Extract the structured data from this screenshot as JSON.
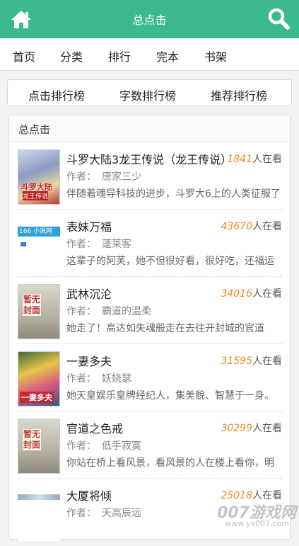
{
  "header": {
    "title": "总点击",
    "home_icon": "home-icon",
    "search_icon": "search-icon",
    "color": "#3cb98f"
  },
  "nav": [
    "首页",
    "分类",
    "排行",
    "完本",
    "书架"
  ],
  "tabs": [
    "点击排行榜",
    "字数排行榜",
    "推荐排行榜"
  ],
  "panel_title": "总点击",
  "unit": "人在看",
  "author_label": "作者：",
  "books": [
    {
      "name": "斗罗大陆3龙王传说（龙王传说）",
      "count": "1841",
      "author": "唐家三少",
      "desc": "伴随着魂导科技的进步，斗罗大6上的人类征服了",
      "cover_text": "斗罗大陆",
      "cover_sub": "龙王传说"
    },
    {
      "name": "表妹万福",
      "count": "43670",
      "author": "蓬莱客",
      "desc": "这辈子的阿芙，她不但很好看，很好吃，还福运",
      "cover_text": "166 小说网",
      "cover_sub": ""
    },
    {
      "name": "武林沉沦",
      "count": "34016",
      "author": "霸道的温柔",
      "desc": "她走了！高达如失魂般走在去往开封城的官道",
      "cover_text": "暂无封面",
      "cover_sub": ""
    },
    {
      "name": "一妻多夫",
      "count": "31595",
      "author": "妖娆瑟",
      "desc": "她天皇娱乐皇牌经纪人，集美貌、智慧于一身。",
      "cover_text": "一妻多夫",
      "cover_sub": ""
    },
    {
      "name": "官道之色戒",
      "count": "30299",
      "author": "低手寂寞",
      "desc": "你站在桥上看风景，看风景的人在楼上看你，明",
      "cover_text": "暂无封面",
      "cover_sub": ""
    },
    {
      "name": "大厦将倾",
      "count": "25018",
      "author": "天高辰远",
      "desc": "",
      "cover_text": "",
      "cover_sub": ""
    }
  ],
  "watermark": "007游戏网",
  "watermark_url": "www.yx007.com"
}
